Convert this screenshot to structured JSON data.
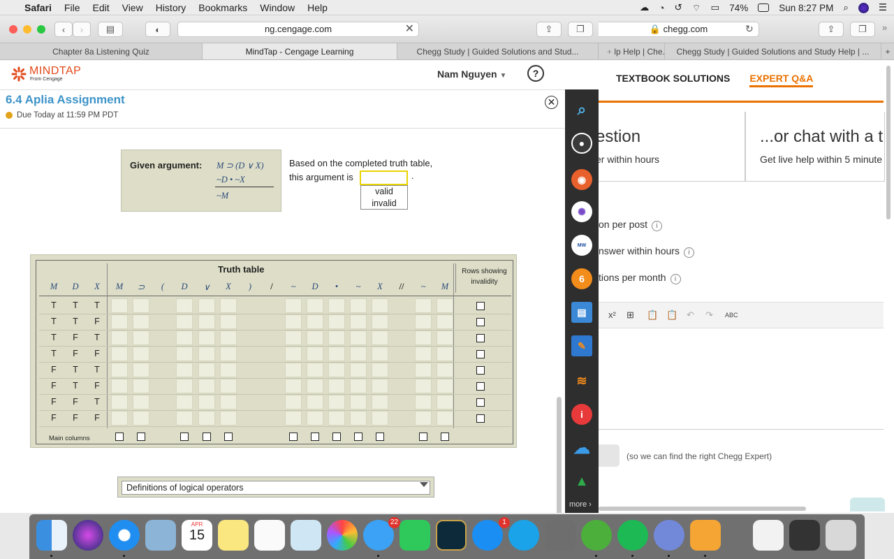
{
  "menubar": {
    "items": [
      "Safari",
      "File",
      "Edit",
      "View",
      "History",
      "Bookmarks",
      "Window",
      "Help"
    ],
    "battery": "74%",
    "clock": "Sun 8:27 PM"
  },
  "left_browser": {
    "url": "ng.cengage.com",
    "tabs": [
      "Chapter 8a Listening Quiz",
      "MindTap - Cengage Learning",
      "Chegg Study | Guided Solutions and Stud..."
    ]
  },
  "mindtap": {
    "logo_big": "MINDTAP",
    "logo_small": "From Cengage",
    "user_name": "Nam Nguyen",
    "help": "?",
    "assignment_title": "6.4 Aplia Assignment",
    "due": "Due Today at 11:59 PM PDT"
  },
  "argument": {
    "label": "Given argument:",
    "premise1": "M ⊃ (D ∨ X)",
    "premise2": "~D • ~X",
    "conclusion": "~M",
    "prompt_line1": "Based on the completed truth table,",
    "prompt_line2": "this argument is",
    "period": ".",
    "options": [
      "valid",
      "invalid"
    ]
  },
  "truth_table": {
    "title": "Truth table",
    "rows_header": "Rows showing invalidity",
    "headers": [
      "M",
      "D",
      "X",
      "M",
      "⊃",
      "(",
      "D",
      "∨",
      "X",
      ")",
      "/",
      "~",
      "D",
      "•",
      "~",
      "X",
      "//",
      "~",
      "M"
    ],
    "rows": [
      [
        "T",
        "T",
        "T"
      ],
      [
        "T",
        "T",
        "F"
      ],
      [
        "T",
        "F",
        "T"
      ],
      [
        "T",
        "F",
        "F"
      ],
      [
        "F",
        "T",
        "T"
      ],
      [
        "F",
        "T",
        "F"
      ],
      [
        "F",
        "F",
        "T"
      ],
      [
        "F",
        "F",
        "F"
      ]
    ],
    "main_columns_label": "Main columns"
  },
  "definitions": {
    "label": "Definitions of logical operators"
  },
  "sidebar": {
    "more": "more"
  },
  "right_browser": {
    "url": "chegg.com",
    "tabs": [
      "lp Help | Che...",
      "Chegg Study | Guided Solutions and Study Help | ..."
    ],
    "nav": [
      "TEXTBOOK SOLUTIONS",
      "EXPERT Q&A"
    ],
    "card1_title": "estion",
    "card1_sub": "er within hours",
    "card2_title": "...or chat with a t",
    "card2_sub": "Get live help within 5 minute",
    "features": [
      "on per post",
      "nswer within hours",
      "tions per month"
    ],
    "editor_tools": [
      "x²",
      "⊞",
      "📋",
      "📋",
      "↶",
      "↷",
      "ABC"
    ],
    "note": "(so we can find the right Chegg Expert)"
  },
  "dock": {
    "calendar_month": "APR",
    "calendar_day": "15",
    "messages_badge": "22",
    "appstore_badge": "1"
  },
  "colors": {
    "accent": "#eb7100",
    "mindtap_orange": "#e2491a",
    "title_blue": "#3d93c9",
    "panel": "#dedec8"
  }
}
